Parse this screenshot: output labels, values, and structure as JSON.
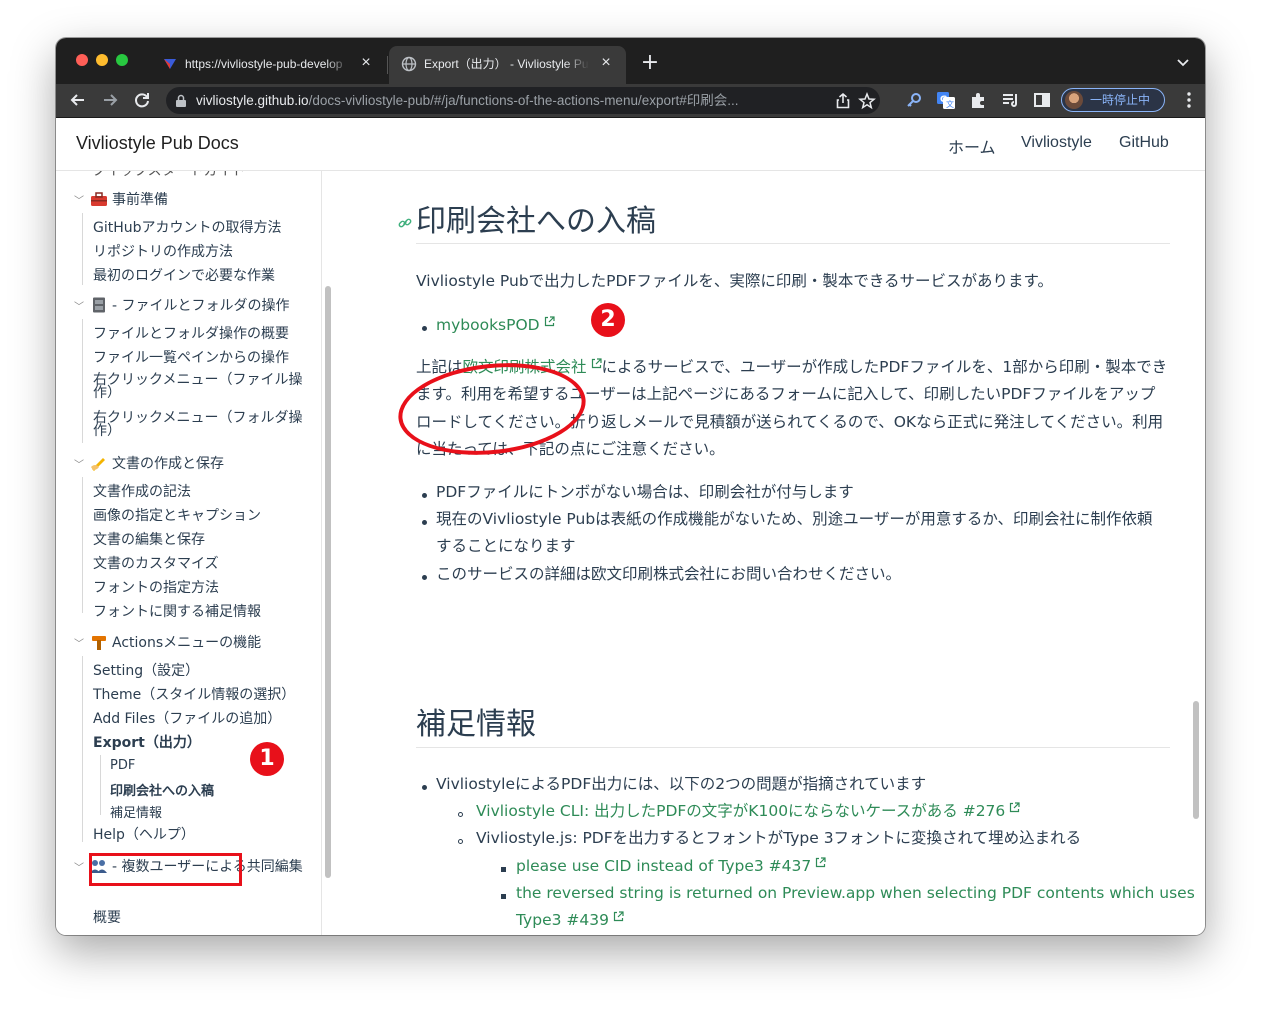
{
  "browser": {
    "tabs": [
      {
        "title": "https://vivliostyle-pub-develop",
        "active": false
      },
      {
        "title": "Export（出力） - Vivliostyle Pub",
        "active": true
      }
    ],
    "url_domain": "vivliostyle.github.io",
    "url_path": "/docs-vivliostyle-pub/#/ja/functions-of-the-actions-menu/export#印刷会...",
    "profile_label": "一時停止中"
  },
  "site": {
    "title": "Vivliostyle Pub Docs",
    "nav": [
      "ホーム",
      "Vivliostyle",
      "GitHub"
    ]
  },
  "sidebar": {
    "clipped_text": "クイックスタートガイド",
    "sections": [
      {
        "label": "事前準備",
        "items": [
          "GitHubアカウントの取得方法",
          "リポジトリの作成方法",
          "最初のログインで必要な作業"
        ]
      },
      {
        "label": "- ファイルとフォルダの操作",
        "items": [
          "ファイルとフォルダ操作の概要",
          "ファイル一覧ペインからの操作",
          "右クリックメニュー（ファイル操作）",
          "右クリックメニュー（フォルダ操作）"
        ]
      },
      {
        "label": "文書の作成と保存",
        "items": [
          "文書作成の記法",
          "画像の指定とキャプション",
          "文書の編集と保存",
          "文書のカスタマイズ",
          "フォントの指定方法",
          "フォントに関する補足情報"
        ]
      },
      {
        "label": "Actionsメニューの機能",
        "items": [
          "Setting（設定）",
          "Theme（スタイル情報の選択）",
          "Add Files（ファイルの追加）",
          "Export（出力）",
          "Help（ヘルプ）"
        ],
        "subitems": [
          "PDF",
          "印刷会社への入稿",
          "補足情報"
        ]
      },
      {
        "label": "- 複数ユーザーによる共同編集",
        "items": [
          "概要"
        ]
      }
    ]
  },
  "content": {
    "section1": {
      "heading": "印刷会社への入稿",
      "intro": "Vivliostyle Pubで出力したPDFファイルを、実際に印刷・製本できるサービスがあります。",
      "link": "mybooksPOD",
      "para_before": "上記は",
      "para_link": "欧文印刷株式会社",
      "para_after": "によるサービスで、ユーザーが作成したPDFファイルを、1部から印刷・製本できます。利用を希望するユーザーは上記ページにあるフォームに記入して、印刷したいPDFファイルをアップロードしてください。折り返しメールで見積額が送られてくるので、OKなら正式に発注してください。利用に当たっては、下記の点にご注意ください。",
      "bullets": [
        "PDFファイルにトンボがない場合は、印刷会社が付与します",
        "現在のVivliostyle Pubは表紙の作成機能がないため、別途ユーザーが用意するか、印刷会社に制作依頼",
        "することになります",
        "このサービスの詳細は欧文印刷株式会社にお問い合わせください。"
      ]
    },
    "section2": {
      "heading": "補足情報",
      "bullet": "VivliostyleによるPDF出力には、以下の2つの問題が指摘されています",
      "sub1": "Vivliostyle CLI: 出力したPDFの文字がK100にならないケースがある #276",
      "sub2": "Vivliostyle.js: PDFを出力するとフォントがType 3フォントに変換されて埋め込まれる",
      "subsub1": "please use CID instead of Type3 #437",
      "subsub2a": "the reversed string is returned on Preview.app when selecting PDF contents which uses",
      "subsub2b": "Type3 #439"
    }
  },
  "annotations": {
    "badge1": "1",
    "badge2": "2",
    "accent": "#e8101a"
  }
}
